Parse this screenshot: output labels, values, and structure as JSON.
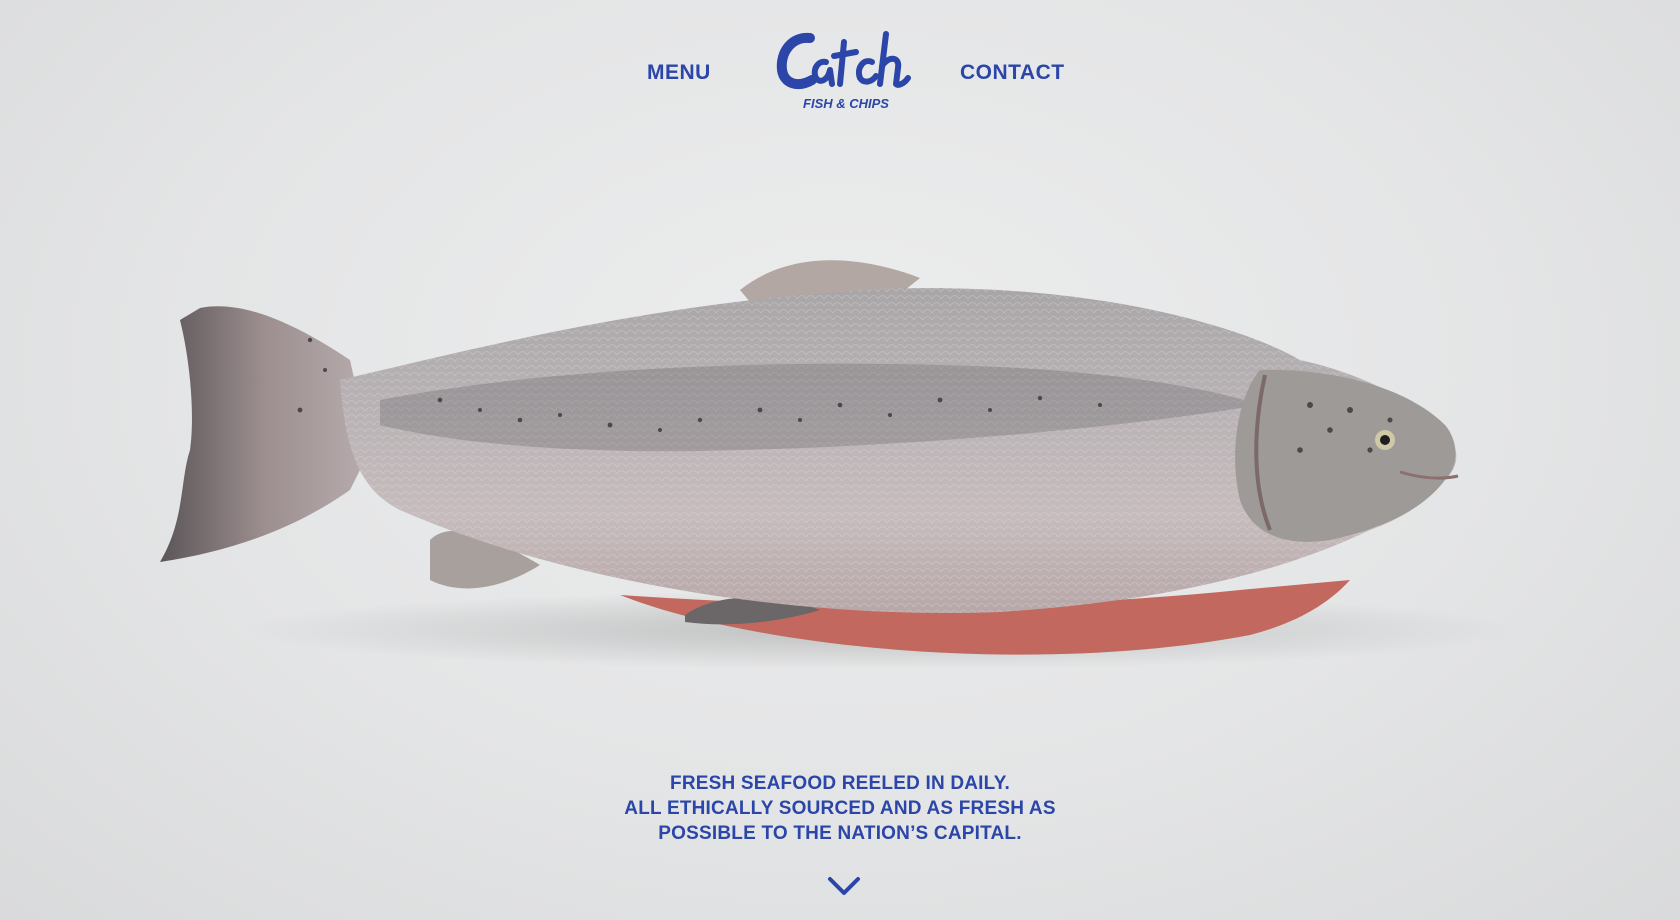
{
  "nav": {
    "menu_label": "MENU",
    "contact_label": "CONTACT"
  },
  "logo": {
    "wordmark": "Catch",
    "subtitle": "FISH & CHIPS"
  },
  "hero": {
    "image_subject": "whole-raw-salmon-fish",
    "tagline_lines": [
      "FRESH SEAFOOD REELED IN DAILY.",
      "ALL ETHICALLY SOURCED AND AS FRESH AS",
      "POSSIBLE TO THE NATION’S CAPITAL."
    ]
  },
  "icons": {
    "scroll": "chevron-down-icon"
  },
  "colors": {
    "brand_blue": "#2b46a8",
    "background": "#e4e5e6"
  }
}
